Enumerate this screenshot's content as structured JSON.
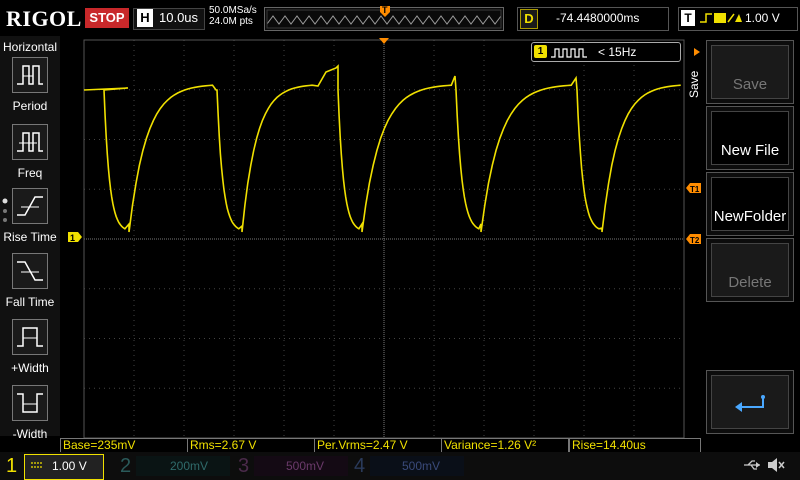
{
  "header": {
    "brand": "RIGOL",
    "run_state": "STOP",
    "timebase_letter": "H",
    "timebase": "10.0us",
    "sample_rate": "50.0MSa/s",
    "memory_depth": "24.0M pts",
    "trigger_position_marker": "T",
    "delay_letter": "D",
    "delay": "-74.4480000ms",
    "trigger_letter": "T",
    "trigger_level": "1.00 V"
  },
  "left_menu": {
    "title": "Horizontal",
    "items": [
      {
        "label": "Period"
      },
      {
        "label": "Freq"
      },
      {
        "label": "Rise Time"
      },
      {
        "label": "Fall Time"
      },
      {
        "label": "+Width"
      },
      {
        "label": "-Width"
      }
    ]
  },
  "right_menu": {
    "title": "Save",
    "buttons": [
      {
        "label": "Save",
        "enabled": false
      },
      {
        "label": "New File",
        "enabled": true
      },
      {
        "label": "NewFolder",
        "enabled": true
      },
      {
        "label": "Delete",
        "enabled": false
      }
    ],
    "back_icon": "return-arrow-icon"
  },
  "trigger_info": {
    "channel": "1",
    "condition": "< 15Hz"
  },
  "markers": {
    "ch1_ground": "1",
    "t1": "T1",
    "t2": "T2"
  },
  "measurements": [
    {
      "label": "Base=235mV"
    },
    {
      "label": "Rms=2.67 V"
    },
    {
      "label": "Per.Vrms=2.47 V"
    },
    {
      "label": "Variance=1.26 V²"
    },
    {
      "label": "Rise=14.40us"
    }
  ],
  "channels": [
    {
      "num": "1",
      "scale": "1.00 V",
      "color": "#f0e000",
      "active": true
    },
    {
      "num": "2",
      "scale": "200mV",
      "color": "#00c8c8",
      "active": false
    },
    {
      "num": "3",
      "scale": "500mV",
      "color": "#d040d0",
      "active": false
    },
    {
      "num": "4",
      "scale": "500mV",
      "color": "#3080ff",
      "active": false
    }
  ],
  "colors": {
    "ch1": "#f0e000",
    "grid": "#555555",
    "stop": "#c8282a",
    "trigger_marker": "#ff8c00"
  }
}
